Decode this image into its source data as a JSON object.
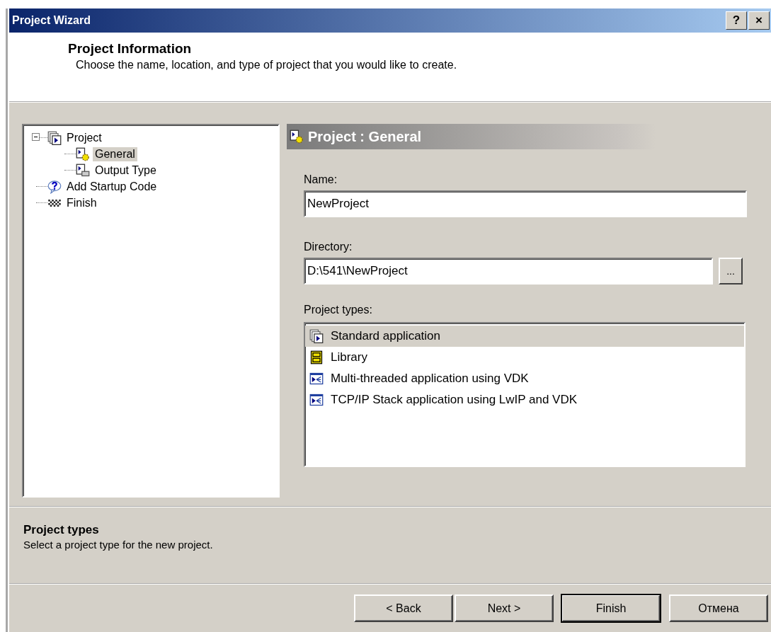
{
  "window": {
    "title": "Project Wizard",
    "buttons": [
      "?",
      "×"
    ]
  },
  "header": {
    "title": "Project Information",
    "subtitle": "Choose the name, location, and type of project that you would like to create."
  },
  "tree": [
    {
      "label": "Project",
      "kind": "project",
      "selected": false,
      "expanded": true,
      "children": [
        {
          "label": "General",
          "kind": "general",
          "selected": true
        },
        {
          "label": "Output Type",
          "kind": "output",
          "selected": false
        }
      ]
    },
    {
      "label": "Add Startup Code",
      "kind": "help",
      "selected": false
    },
    {
      "label": "Finish",
      "kind": "finish",
      "selected": false
    }
  ],
  "page": {
    "title": "Project : General",
    "name": {
      "label": "Name:",
      "value": "NewProject"
    },
    "directory": {
      "label": "Directory:",
      "value": "D:\\541\\NewProject",
      "browse": "..."
    },
    "types": {
      "label": "Project types:",
      "items": [
        {
          "label": "Standard application",
          "kind": "application",
          "selected": true
        },
        {
          "label": "Library",
          "kind": "library",
          "selected": false
        },
        {
          "label": "Multi-threaded application using VDK",
          "kind": "vdk",
          "selected": false
        },
        {
          "label": "TCP/IP Stack application using LwIP and VDK",
          "kind": "vdk",
          "selected": false
        }
      ]
    }
  },
  "help": {
    "title": "Project types",
    "text": "Select a project type for the new project."
  },
  "buttons": [
    {
      "label": "< Back",
      "default": false
    },
    {
      "label": "Next >",
      "default": false
    },
    {
      "label": "Finish",
      "default": true
    },
    {
      "label": "Отмена",
      "default": false
    }
  ]
}
